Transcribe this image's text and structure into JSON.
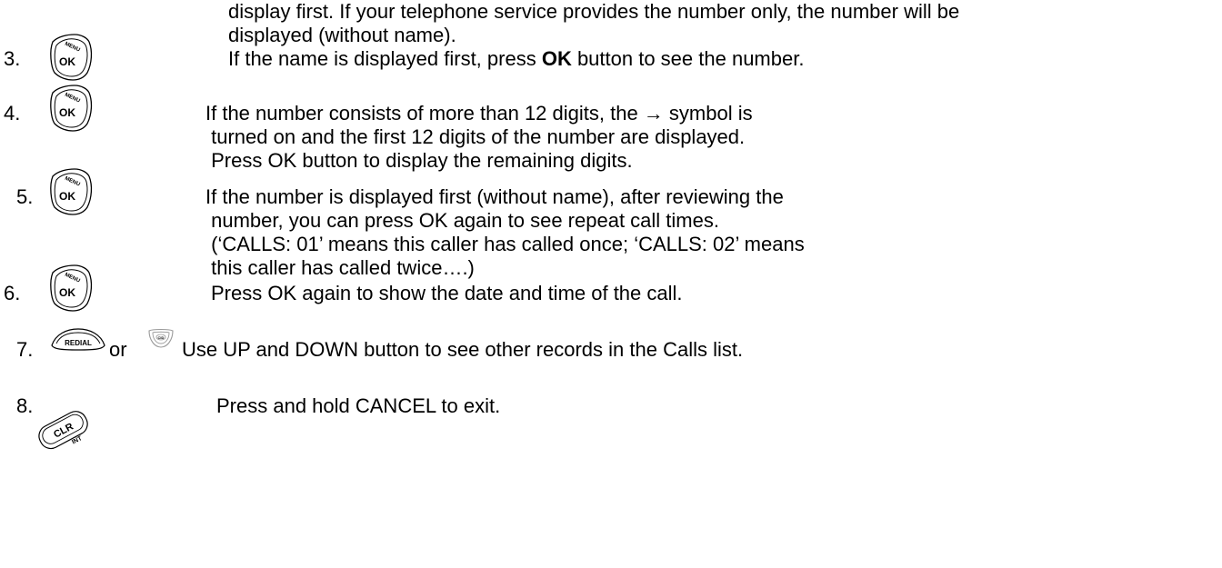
{
  "intro": {
    "line1": "display first.  If your telephone service provides the number only, the number will be",
    "line2": "displayed (without name)."
  },
  "steps": [
    {
      "number": "3.",
      "key": {
        "main": "OK",
        "sub": "MENU"
      },
      "lines": [
        {
          "before": "If the name is displayed first, press ",
          "bold": "OK",
          "after": " button to see the number."
        }
      ]
    },
    {
      "number": "4.",
      "key": {
        "main": "OK",
        "sub": "MENU"
      },
      "lines": [
        "If the number consists of more than 12 digits, the → symbol is",
        " turned on and the first 12 digits of the number are displayed.",
        " Press OK button to display the remaining digits."
      ]
    },
    {
      "number": "5.",
      "key": {
        "main": "OK",
        "sub": "MENU"
      },
      "lines": [
        "If the number is displayed first (without name), after reviewing the",
        " number, you can press OK again to see repeat call times.",
        " (‘CALLS: 01’ means this caller has called once; ‘CALLS: 02’ means",
        " this caller has called twice….)"
      ]
    },
    {
      "number": "6.",
      "key": {
        "main": "OK",
        "sub": "MENU"
      },
      "lines": [
        "Press OK again to show the date and time of the call."
      ]
    },
    {
      "number": "7.",
      "key": {
        "main": "REDIAL",
        "alt": "CID",
        "or": "or"
      },
      "lines": [
        "Use UP and DOWN button to see other records in the Calls list."
      ]
    },
    {
      "number": "8.",
      "key": {
        "main": "CLR",
        "sub": "INT"
      },
      "lines": [
        "Press and hold CANCEL to exit."
      ]
    }
  ]
}
